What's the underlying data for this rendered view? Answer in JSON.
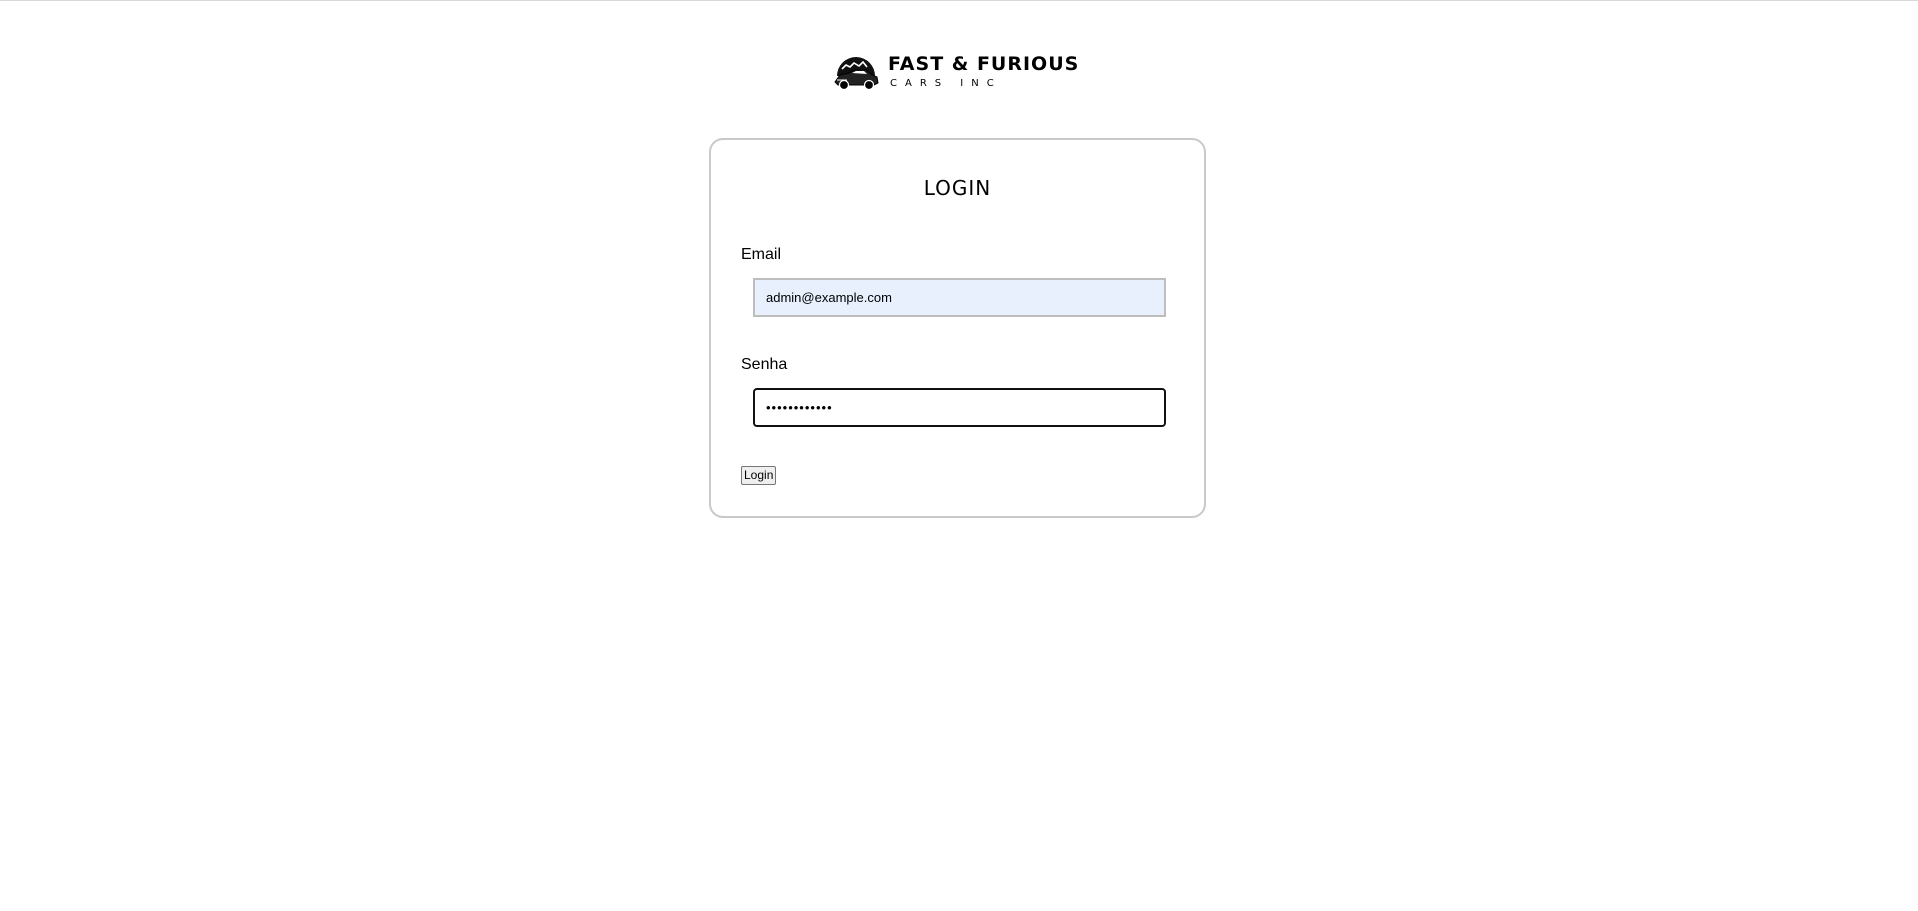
{
  "brand": {
    "title": "FAST & FURIOUS",
    "subtitle": "CARS INC",
    "logo_icon": "car-logo-icon"
  },
  "login_card": {
    "title": "LOGIN",
    "email_label": "Email",
    "email_value": "admin@example.com",
    "password_label": "Senha",
    "password_value": "••••••••••••",
    "submit_label": "Login"
  },
  "colors": {
    "autofill_background": "#e8f0fe",
    "card_border": "#c9c9c9"
  }
}
